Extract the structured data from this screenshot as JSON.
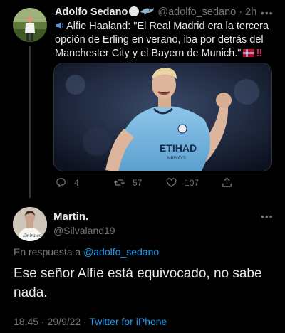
{
  "tweet": {
    "author_name": "Adolfo Sedano",
    "handle": "@adolfo_sedano",
    "separator": "·",
    "time": "2h",
    "text": "Alfie Haaland: \"El Real Madrid era la tercera opción de Erling en verano, iba por detrás del Manchester City y el Bayern de Munich.\"",
    "text_suffix": "‼",
    "media_alt_icon": "football-player-photo",
    "stats": {
      "replies": "4",
      "retweets": "57",
      "likes": "107"
    }
  },
  "reply": {
    "author_name": "Martin.",
    "handle": "@Silvaland19",
    "replying_prefix": "En respuesta a",
    "replying_to": "@adolfo_sedano",
    "text": "Ese señor Alfie está equivocado, no sabe nada.",
    "timestamp": "18:45 · 29/9/22 ·",
    "client": "Twitter for iPhone"
  },
  "colors": {
    "background": "#000000",
    "text": "#e7e9ea",
    "muted": "#71767b",
    "link": "#1d9bf0",
    "alert": "#e0245e"
  },
  "icons": [
    "more-icon",
    "speaker-icon",
    "flag-icon",
    "reply-icon",
    "retweet-icon",
    "like-icon",
    "share-icon"
  ]
}
